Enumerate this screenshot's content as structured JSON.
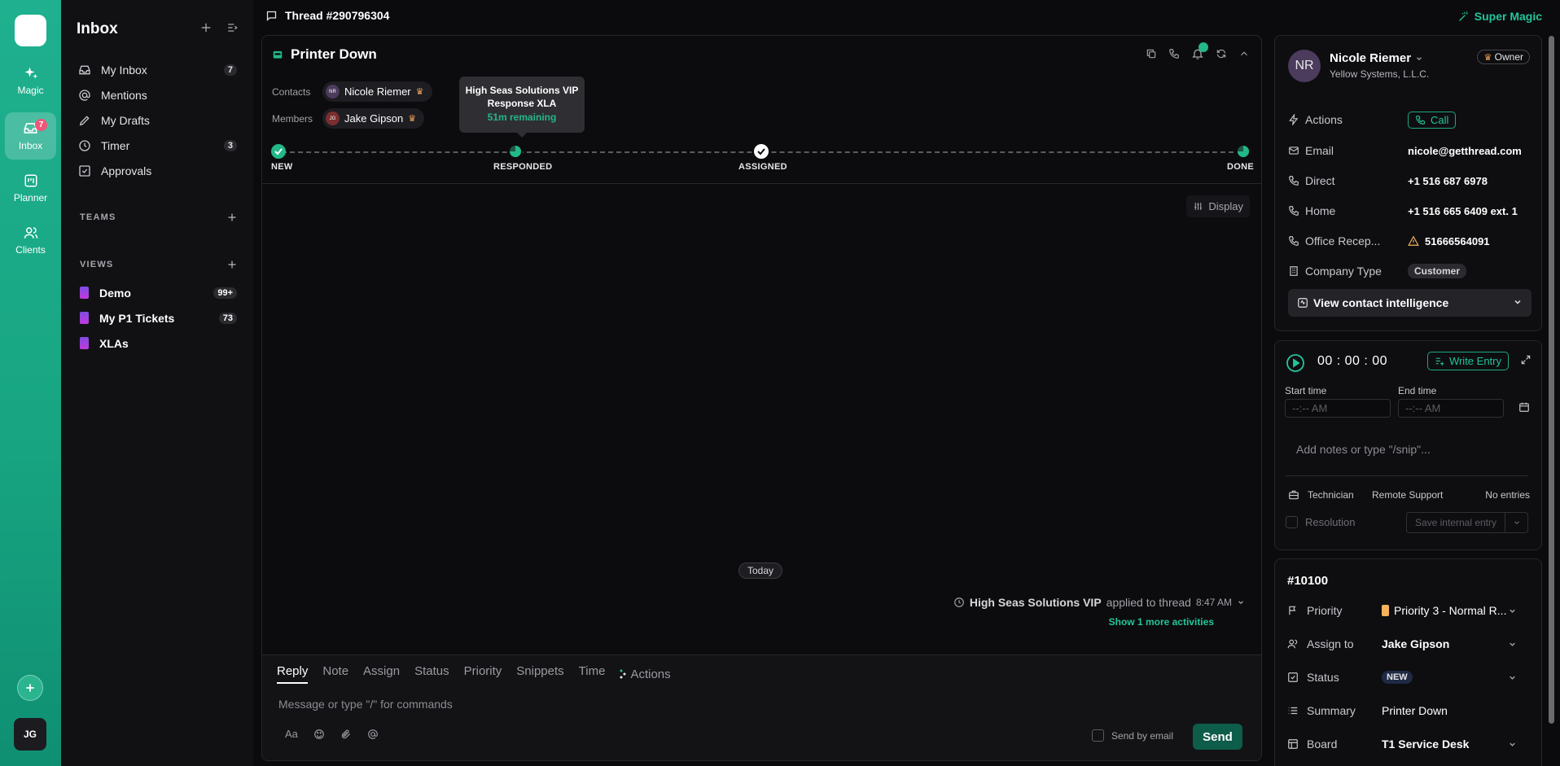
{
  "rail": {
    "items": [
      {
        "label": "Magic"
      },
      {
        "label": "Inbox",
        "badge": "7"
      },
      {
        "label": "Planner"
      },
      {
        "label": "Clients"
      }
    ],
    "avatar": "JG"
  },
  "sidebar": {
    "title": "Inbox",
    "nav": [
      {
        "label": "My Inbox",
        "count": "7"
      },
      {
        "label": "Mentions",
        "count": ""
      },
      {
        "label": "My Drafts",
        "count": ""
      },
      {
        "label": "Timer",
        "count": "3"
      },
      {
        "label": "Approvals",
        "count": ""
      }
    ],
    "teams_heading": "TEAMS",
    "views_heading": "VIEWS",
    "views": [
      {
        "label": "Demo",
        "count": "99+"
      },
      {
        "label": "My P1 Tickets",
        "count": "73"
      },
      {
        "label": "XLAs",
        "count": ""
      }
    ]
  },
  "topbar": {
    "thread_title": "Thread #290796304",
    "super_magic": "Super Magic"
  },
  "thread": {
    "title": "Printer Down",
    "contacts_label": "Contacts",
    "members_label": "Members",
    "contact": {
      "initials": "NR",
      "name": "Nicole Riemer"
    },
    "member": {
      "initials": "JG",
      "name": "Jake Gipson"
    },
    "xla": {
      "title": "High Seas Solutions VIP Response XLA",
      "remaining": "51m remaining"
    },
    "timeline": [
      "NEW",
      "RESPONDED",
      "ASSIGNED",
      "DONE"
    ],
    "display_label": "Display",
    "today_label": "Today",
    "activity": {
      "actor": "High Seas Solutions VIP",
      "text": "applied to thread",
      "time": "8:47 AM"
    },
    "more_activities": "Show 1 more activities"
  },
  "composer": {
    "tabs": [
      "Reply",
      "Note",
      "Assign",
      "Status",
      "Priority",
      "Snippets",
      "Time",
      "Actions"
    ],
    "placeholder": "Message or type \"/\" for commands",
    "font_label": "Aa",
    "send_by_email": "Send by email",
    "send": "Send"
  },
  "contact_card": {
    "initials": "NR",
    "name": "Nicole Riemer",
    "company": "Yellow Systems, L.L.C.",
    "role": "Owner",
    "actions_label": "Actions",
    "call_label": "Call",
    "rows": [
      {
        "key": "Email",
        "value": "nicole@getthread.com"
      },
      {
        "key": "Direct",
        "value": "+1 516 687 6978"
      },
      {
        "key": "Home",
        "value": "+1 516 665 6409 ext. 1"
      },
      {
        "key": "Office Recep...",
        "value": "51666564091"
      }
    ],
    "company_type_label": "Company Type",
    "company_type": "Customer",
    "intel_label": "View contact intelligence"
  },
  "timer_card": {
    "time": "00 : 00 : 00",
    "write_entry": "Write Entry",
    "start_label": "Start time",
    "end_label": "End time",
    "time_placeholder": "--:-- AM",
    "notes_placeholder": "Add notes or type \"/snip\"...",
    "technician": "Technician",
    "work_type": "Remote Support",
    "entries": "No entries",
    "resolution": "Resolution",
    "save_internal": "Save internal entry"
  },
  "ticket_card": {
    "number": "#10100",
    "rows": [
      {
        "key": "Priority",
        "value": "Priority 3 - Normal R..."
      },
      {
        "key": "Assign to",
        "value": "Jake Gipson"
      },
      {
        "key": "Status",
        "value": "NEW"
      },
      {
        "key": "Summary",
        "value": "Printer Down"
      },
      {
        "key": "Board",
        "value": "T1 Service Desk"
      }
    ]
  },
  "colors": {
    "accent": "#22c59b",
    "rail": "#1fb08f",
    "priority": "#f5b25a",
    "badge": "#f0567a"
  }
}
